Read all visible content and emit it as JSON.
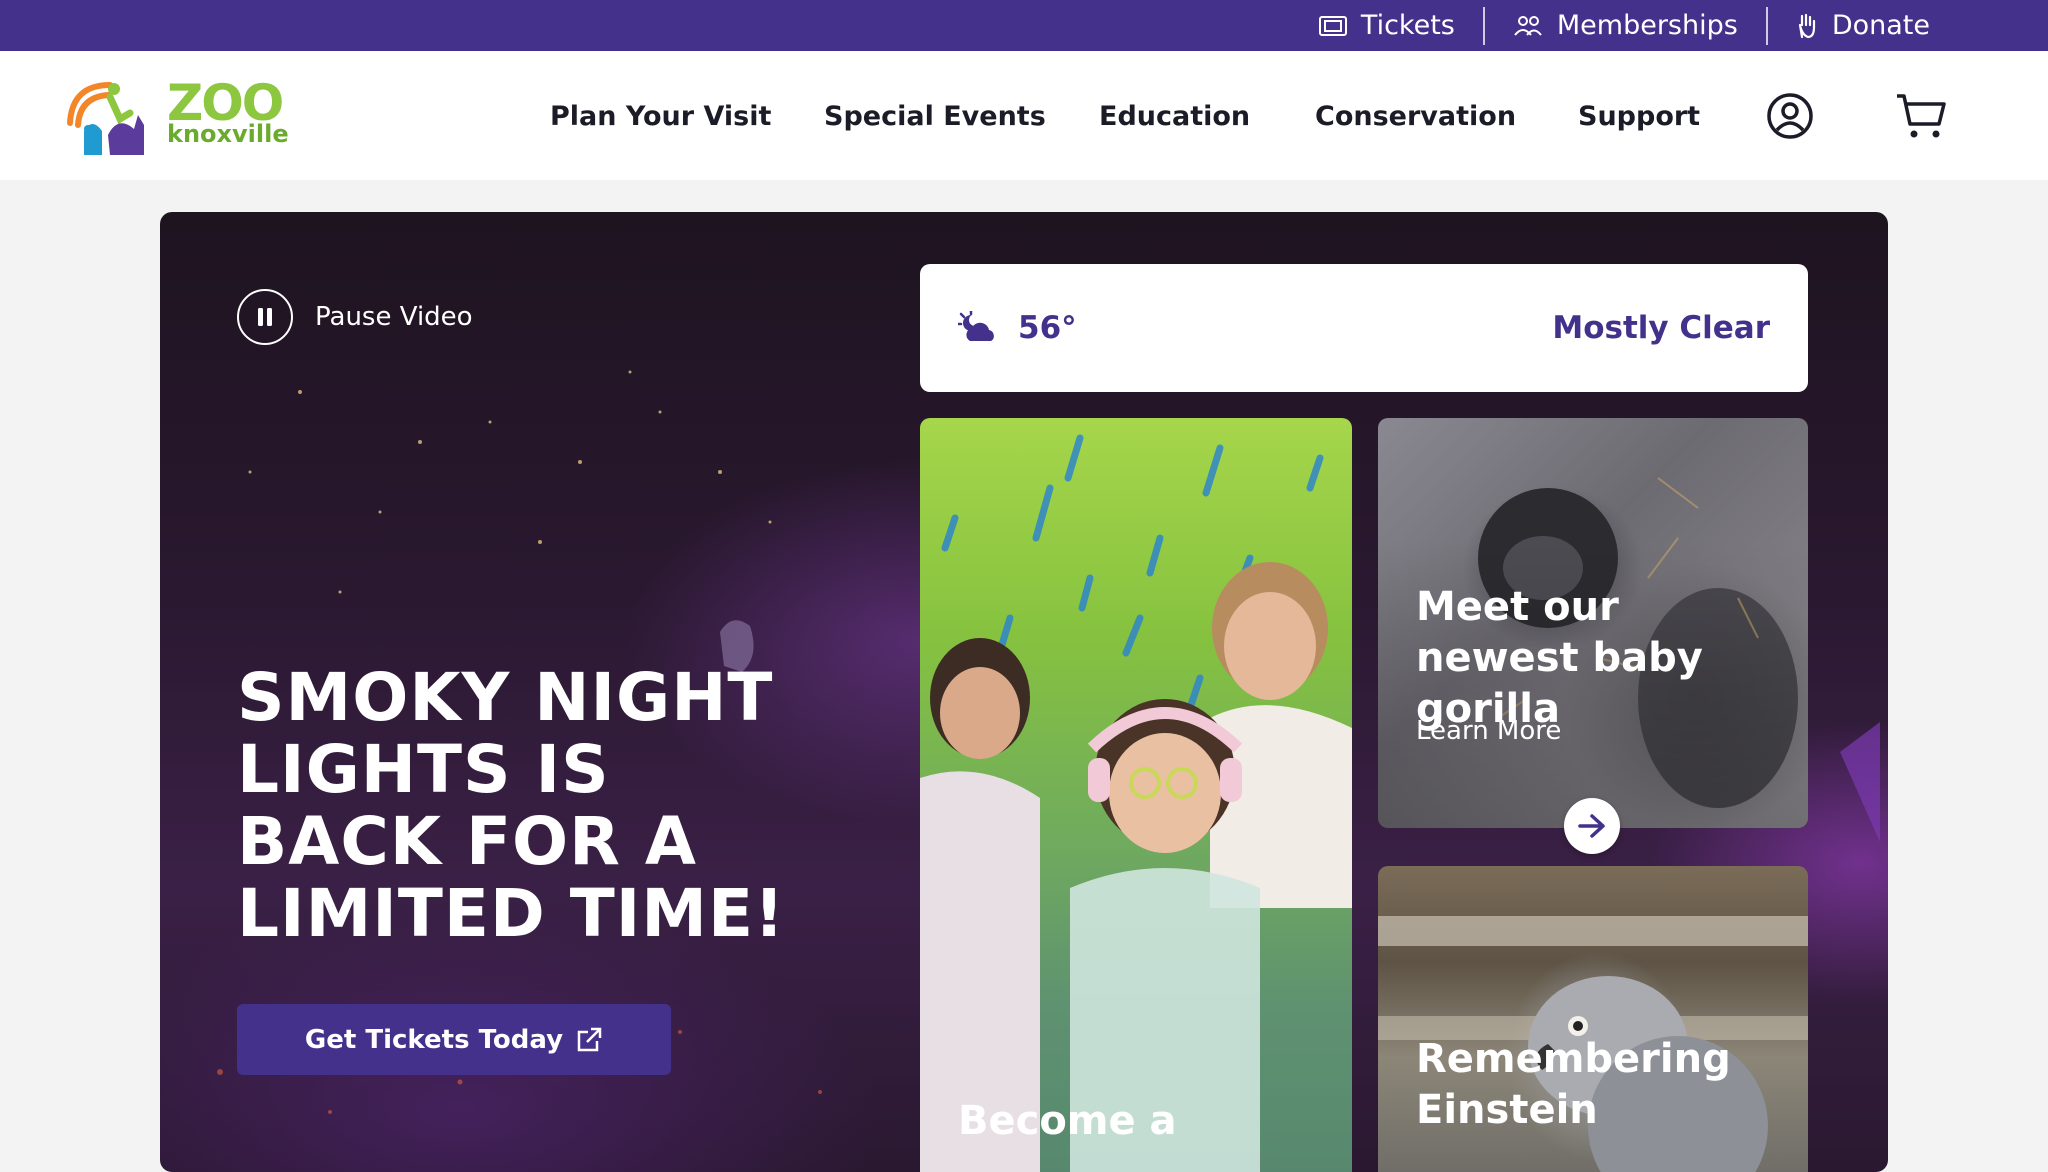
{
  "utility_bar": {
    "links": [
      {
        "label": "Tickets",
        "icon": "ticket-icon"
      },
      {
        "label": "Memberships",
        "icon": "people-icon"
      },
      {
        "label": "Donate",
        "icon": "hand-icon"
      }
    ]
  },
  "logo": {
    "line1": "ZOO",
    "line2": "knoxville"
  },
  "nav": {
    "items": [
      "Plan Your Visit",
      "Special Events",
      "Education",
      "Conservation",
      "Support"
    ],
    "account_icon": "account-icon",
    "cart_icon": "cart-icon"
  },
  "hero": {
    "pause_label": "Pause Video",
    "heading": "Smoky Night Lights is back for a limited time!",
    "cta_label": "Get Tickets Today"
  },
  "weather": {
    "icon": "partly-cloudy-night-icon",
    "temperature": "56°",
    "condition": "Mostly Clear"
  },
  "cards": [
    {
      "title": "Become a"
    },
    {
      "title": "Meet our newest baby gorilla",
      "link": "Learn More"
    },
    {
      "title": "Remembering Einstein"
    }
  ],
  "colors": {
    "brand_purple": "#43318c",
    "logo_green": "#8dc63f",
    "logo_orange": "#f4862a",
    "logo_teal": "#1f9bd1"
  }
}
